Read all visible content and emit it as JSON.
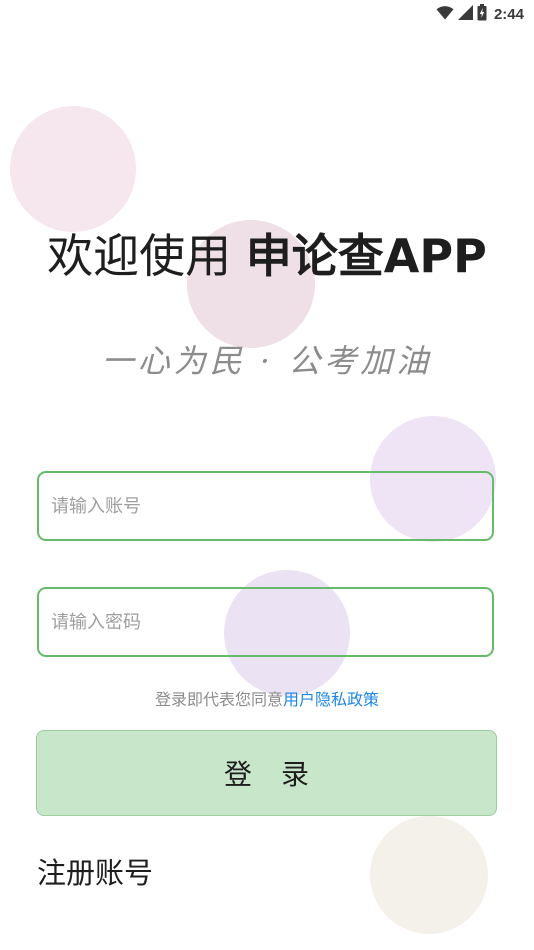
{
  "status_bar": {
    "time": "2:44",
    "icons": [
      "wifi-icon",
      "cellular-signal-icon",
      "battery-icon"
    ]
  },
  "header": {
    "title_regular": "欢迎使用 ",
    "title_bold": "申论查APP",
    "slogan": "一心为民 · 公考加油"
  },
  "form": {
    "account_placeholder": "请输入账号",
    "account_value": "",
    "password_placeholder": "请输入密码",
    "password_value": ""
  },
  "agreement": {
    "prefix": "登录即代表您同意",
    "link": "用户隐私政策"
  },
  "actions": {
    "login_label": "登 录",
    "register_label": "注册账号"
  },
  "colors": {
    "field_border": "#66bb6a",
    "login_bg": "#c8e6c9",
    "link": "#1e88e5"
  }
}
